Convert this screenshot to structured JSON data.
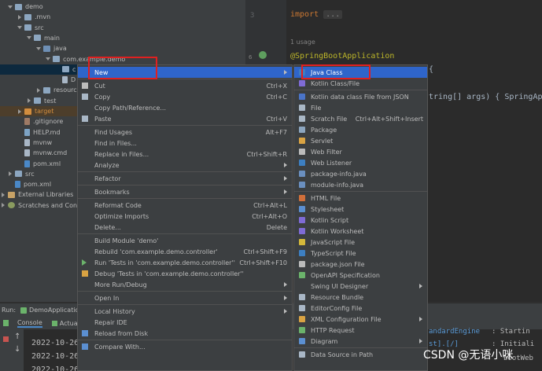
{
  "tree": [
    {
      "label": "demo",
      "arrow": "down",
      "icon": "folder",
      "indent": 0
    },
    {
      "label": ".mvn",
      "arrow": "right",
      "icon": "folder",
      "indent": 1
    },
    {
      "label": "src",
      "arrow": "down",
      "icon": "folder",
      "indent": 1
    },
    {
      "label": "main",
      "arrow": "down",
      "icon": "folder",
      "indent": 2
    },
    {
      "label": "java",
      "arrow": "down",
      "icon": "folder src",
      "indent": 3
    },
    {
      "label": "com.example.demo",
      "arrow": "down",
      "icon": "pkg",
      "indent": 4
    },
    {
      "label": "c",
      "arrow": "none",
      "icon": "pkg",
      "indent": 5,
      "selected": true
    },
    {
      "label": "D",
      "arrow": "none",
      "icon": "fileico",
      "indent": 5
    },
    {
      "label": "resourc",
      "arrow": "right",
      "icon": "folder",
      "indent": 3
    },
    {
      "label": "test",
      "arrow": "right",
      "icon": "folder",
      "indent": 2
    },
    {
      "label": "target",
      "arrow": "right",
      "icon": "folder orange",
      "indent": 1,
      "target": true
    },
    {
      "label": ".gitignore",
      "arrow": "none",
      "icon": "fileico git",
      "indent": 1
    },
    {
      "label": "HELP.md",
      "arrow": "none",
      "icon": "fileico md",
      "indent": 1
    },
    {
      "label": "mvnw",
      "arrow": "none",
      "icon": "fileico",
      "indent": 1
    },
    {
      "label": "mvnw.cmd",
      "arrow": "none",
      "icon": "fileico",
      "indent": 1
    },
    {
      "label": "pom.xml",
      "arrow": "none",
      "icon": "fileico xml",
      "indent": 1
    },
    {
      "label": "src",
      "arrow": "right",
      "icon": "folder",
      "indent": 0
    },
    {
      "label": "pom.xml",
      "arrow": "none",
      "icon": "fileico xml",
      "indent": 0
    },
    {
      "label": "External Libraries",
      "arrow": "right",
      "icon": "libico",
      "indent": -1
    },
    {
      "label": "Scratches and Cons",
      "arrow": "right",
      "icon": "scratchico",
      "indent": -1
    }
  ],
  "editor": {
    "line3": "3",
    "import_kw": "import",
    "import_fold": "...",
    "usage": "1 usage",
    "annotation": "@SpringBootApplication",
    "brace": "{",
    "main_sig": "tring[] args) { SpringApp"
  },
  "run": {
    "run_label": "Run:",
    "config": "DemoApplicatio",
    "tab_console": "Console",
    "tab_actuator": "Actua",
    "log_date": "2022-10-26",
    "log_right_1": "andardEngine",
    "log_right_1b": ": Startin",
    "log_right_2": "st].[/]",
    "log_right_2b": ": Initiali",
    "log_right_3": "bootWeb"
  },
  "context_menu": [
    {
      "label": "New",
      "shortcut": "",
      "submenu": true,
      "highlight": true,
      "icon": ""
    },
    {
      "sep": true
    },
    {
      "label": "Cut",
      "shortcut": "Ctrl+X",
      "icon": "scissors-icon",
      "u": "t"
    },
    {
      "label": "Copy",
      "shortcut": "Ctrl+C",
      "icon": "copy-icon"
    },
    {
      "label": "Copy Path/Reference...",
      "shortcut": ""
    },
    {
      "label": "Paste",
      "shortcut": "Ctrl+V",
      "icon": "paste-icon"
    },
    {
      "sep": true
    },
    {
      "label": "Find Usages",
      "shortcut": "Alt+F7"
    },
    {
      "label": "Find in Files...",
      "shortcut": ""
    },
    {
      "label": "Replace in Files...",
      "shortcut": "Ctrl+Shift+R"
    },
    {
      "label": "Analyze",
      "shortcut": "",
      "submenu": true
    },
    {
      "sep": true
    },
    {
      "label": "Refactor",
      "shortcut": "",
      "submenu": true
    },
    {
      "sep": true
    },
    {
      "label": "Bookmarks",
      "shortcut": "",
      "submenu": true
    },
    {
      "sep": true
    },
    {
      "label": "Reformat Code",
      "shortcut": "Ctrl+Alt+L"
    },
    {
      "label": "Optimize Imports",
      "shortcut": "Ctrl+Alt+O"
    },
    {
      "label": "Delete...",
      "shortcut": "Delete"
    },
    {
      "sep": true
    },
    {
      "label": "Build Module 'demo'",
      "shortcut": ""
    },
    {
      "label": "Rebuild 'com.example.demo.controller'",
      "shortcut": "Ctrl+Shift+F9"
    },
    {
      "label": "Run 'Tests in 'com.example.demo.controller''",
      "shortcut": "Ctrl+Shift+F10",
      "icon": "run-icon"
    },
    {
      "label": "Debug 'Tests in 'com.example.demo.controller''",
      "shortcut": "",
      "icon": "debug-icon"
    },
    {
      "label": "More Run/Debug",
      "shortcut": "",
      "submenu": true
    },
    {
      "sep": true
    },
    {
      "label": "Open In",
      "shortcut": "",
      "submenu": true
    },
    {
      "sep": true
    },
    {
      "label": "Local History",
      "shortcut": "",
      "submenu": true
    },
    {
      "label": "Repair IDE",
      "shortcut": ""
    },
    {
      "label": "Reload from Disk",
      "shortcut": "",
      "icon": "reload-icon"
    },
    {
      "sep": true
    },
    {
      "label": "Compare With...",
      "shortcut": "",
      "icon": "compare-icon"
    }
  ],
  "new_submenu": [
    {
      "label": "Java Class",
      "shortcut": "",
      "highlight": true,
      "icon": "java-class-icon",
      "color": "#3d7fc1"
    },
    {
      "label": "Kotlin Class/File",
      "shortcut": "",
      "icon": "kotlin-icon",
      "color": "#7f6bd6"
    },
    {
      "sep": true
    },
    {
      "label": "Kotlin data class File from JSON",
      "shortcut": "",
      "icon": "json-kotlin-icon",
      "color": "#4a74c9"
    },
    {
      "label": "File",
      "shortcut": "",
      "icon": "file-icon",
      "color": "#a9b7c6"
    },
    {
      "label": "Scratch File",
      "shortcut": "Ctrl+Alt+Shift+Insert",
      "icon": "scratch-icon",
      "color": "#a9b7c6"
    },
    {
      "label": "Package",
      "shortcut": "",
      "icon": "package-icon",
      "color": "#8ca6c0"
    },
    {
      "label": "Servlet",
      "shortcut": "",
      "icon": "servlet-icon",
      "color": "#d9a343"
    },
    {
      "label": "Web Filter",
      "shortcut": "",
      "icon": "filter-icon",
      "color": "#bbbbbb"
    },
    {
      "label": "Web Listener",
      "shortcut": "",
      "icon": "listener-icon",
      "color": "#3d7fc1"
    },
    {
      "label": "package-info.java",
      "shortcut": "",
      "icon": "java-file-icon",
      "color": "#6a8fbf"
    },
    {
      "label": "module-info.java",
      "shortcut": "",
      "icon": "java-file-icon",
      "color": "#6a8fbf"
    },
    {
      "sep": true
    },
    {
      "label": "HTML File",
      "shortcut": "",
      "icon": "html-icon",
      "color": "#d06f3a"
    },
    {
      "label": "Stylesheet",
      "shortcut": "",
      "icon": "css-icon",
      "color": "#5b8fd1"
    },
    {
      "label": "Kotlin Script",
      "shortcut": "",
      "icon": "kotlin-icon",
      "color": "#7f6bd6"
    },
    {
      "label": "Kotlin Worksheet",
      "shortcut": "",
      "icon": "kotlin-icon",
      "color": "#7f6bd6"
    },
    {
      "label": "JavaScript File",
      "shortcut": "",
      "icon": "js-icon",
      "color": "#d4b83a"
    },
    {
      "label": "TypeScript File",
      "shortcut": "",
      "icon": "ts-icon",
      "color": "#3d7fc1"
    },
    {
      "label": "package.json File",
      "shortcut": "",
      "icon": "json-icon",
      "color": "#bbbbbb"
    },
    {
      "label": "OpenAPI Specification",
      "shortcut": "",
      "icon": "openapi-icon",
      "color": "#6bb36b"
    },
    {
      "label": "Swing UI Designer",
      "shortcut": "",
      "submenu": true,
      "icon": "",
      "color": ""
    },
    {
      "label": "Resource Bundle",
      "shortcut": "",
      "icon": "bundle-icon",
      "color": "#a9b7c6"
    },
    {
      "label": "EditorConfig File",
      "shortcut": "",
      "icon": "editorconfig-icon",
      "color": "#a9b7c6"
    },
    {
      "label": "XML Configuration File",
      "shortcut": "",
      "submenu": true,
      "icon": "xml-icon",
      "color": "#d9a343"
    },
    {
      "label": "HTTP Request",
      "shortcut": "",
      "icon": "http-icon",
      "color": "#6bb36b"
    },
    {
      "label": "Diagram",
      "shortcut": "",
      "submenu": true,
      "icon": "diagram-icon",
      "color": "#5b8fd1"
    },
    {
      "sep": true
    },
    {
      "label": "Data Source in Path",
      "shortcut": "",
      "icon": "datasource-icon",
      "color": "#a9b7c6"
    }
  ],
  "watermark": "CSDN @无语小咪"
}
